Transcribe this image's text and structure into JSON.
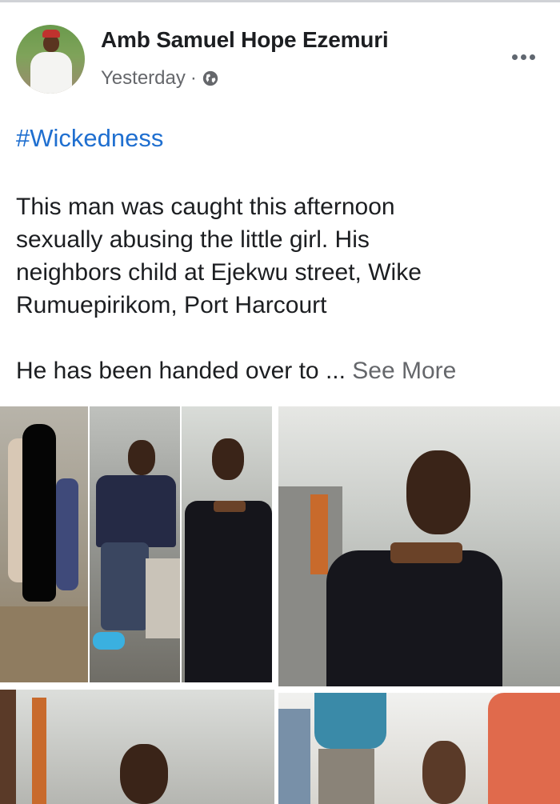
{
  "post": {
    "author": "Amb Samuel Hope Ezemuri",
    "time": "Yesterday",
    "separator": "·",
    "privacy_icon": "globe-icon",
    "more_icon": "more-options-icon",
    "hashtag": "#Wickedness",
    "body": {
      "line1": "This man was caught this afternoon",
      "line2": "sexually abusing the little girl. His",
      "line3": "neighbors child at Ejekwu street, Wike",
      "line4": "Rumuepirikom, Port Harcourt",
      "line5": "He has been handed over to ... ",
      "see_more": "See More"
    }
  },
  "colors": {
    "hashtag": "#1f6fd0",
    "secondary_text": "#65676b",
    "primary_text": "#1c1e21"
  }
}
